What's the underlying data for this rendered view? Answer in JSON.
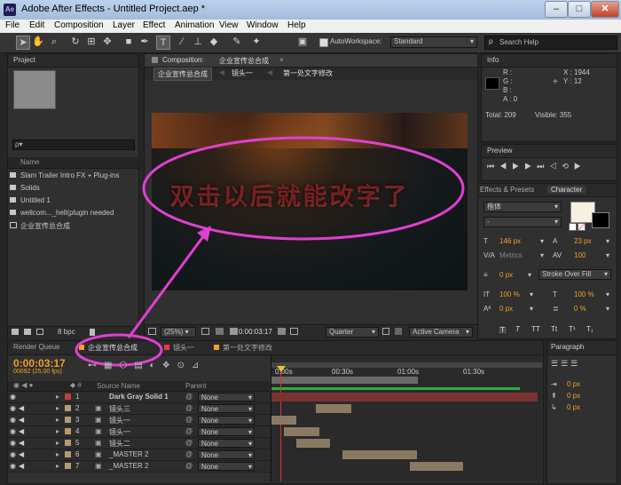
{
  "window": {
    "title": "Adobe After Effects - Untitled Project.aep *",
    "app_icon": "Ae",
    "min": "–",
    "max": "□",
    "close": "✕"
  },
  "menu": [
    "File",
    "Edit",
    "Composition",
    "Layer",
    "Effect",
    "Animation",
    "View",
    "Window",
    "Help"
  ],
  "toolbar": {
    "autoworkspace_label": "AutoWorkspace:",
    "workspace": "Standard",
    "search_placeholder": "Search Help"
  },
  "project": {
    "tab": "Project",
    "search_glyph": "ρ▾",
    "col_name": "Name",
    "items": [
      "Slam Trailer Intro FX + Plug-ins",
      "Solids",
      "Untitled 1",
      "wellcom..._hell(plugin needed",
      "企业宣传总合成"
    ],
    "bpc": "8 bpc"
  },
  "composition": {
    "tab_prefix": "Composition:",
    "tab_name": "企业宣传总合成",
    "breadcrumb": [
      "企业宣传总合成",
      "镜头一",
      "第一处文字修改"
    ],
    "overlay_text": "双击以后就能改字了",
    "zoom": "(25%)",
    "timecode": "0:00:03:17",
    "resolution": "Quarter",
    "camera": "Active Camera"
  },
  "info": {
    "tab": "Info",
    "labels": [
      "R :",
      "G :",
      "B :",
      "A : 0"
    ],
    "x": "X : 1944",
    "y": "Y : 12",
    "total": "Total: 209",
    "visible": "Visible: 355"
  },
  "preview": {
    "tab": "Preview"
  },
  "character": {
    "tabs": [
      "Effects & Presets",
      "Character"
    ],
    "font": "楷体",
    "style": "-",
    "size": "146 px",
    "leading": "23 px",
    "kerning": "Metrics",
    "tracking": "100",
    "stroke": "0 px",
    "stroke_mode": "Stroke Over Fill",
    "vscale": "100 %",
    "hscale": "100 %",
    "baseline": "0 px",
    "tsume": "0 %",
    "buttons": [
      "T",
      "T",
      "TT",
      "Tt",
      "T¹",
      "T₁"
    ],
    "fill_color": "#f5f0e0",
    "stroke_color": "#000000"
  },
  "paragraph": {
    "tab": "Paragraph",
    "fields": [
      "0 px",
      "0 px",
      "0 px"
    ]
  },
  "timeline": {
    "tabs": [
      "Render Queue",
      "企业宣传总合成",
      "镜头一",
      "第一处文字修改"
    ],
    "tab_colors": [
      "#f0a028",
      "#e04040",
      "#f0a028"
    ],
    "timecode": "0:00:03:17",
    "fps": "00092 (25.00 fps)",
    "col_source": "Source Name",
    "col_parent": "Parent",
    "ruler": [
      "0:00s",
      "00:30s",
      "01:00s",
      "01:30s"
    ],
    "layers": [
      {
        "num": "1",
        "name": "Dark Gray Solid 1",
        "parent": "None",
        "color": "#c04040"
      },
      {
        "num": "2",
        "name": "镜头三",
        "parent": "None",
        "color": "#b59a74"
      },
      {
        "num": "3",
        "name": "镜头一",
        "parent": "None",
        "color": "#b59a74"
      },
      {
        "num": "4",
        "name": "镜头一",
        "parent": "None",
        "color": "#b59a74"
      },
      {
        "num": "5",
        "name": "镜头二",
        "parent": "None",
        "color": "#b59a74"
      },
      {
        "num": "6",
        "name": "_MASTER 2",
        "parent": "None",
        "color": "#b59a74"
      },
      {
        "num": "7",
        "name": "_MASTER 2",
        "parent": "None",
        "color": "#b59a74"
      }
    ]
  },
  "colors": {
    "accent": "#f0a028",
    "annotation": "#e040d0"
  }
}
